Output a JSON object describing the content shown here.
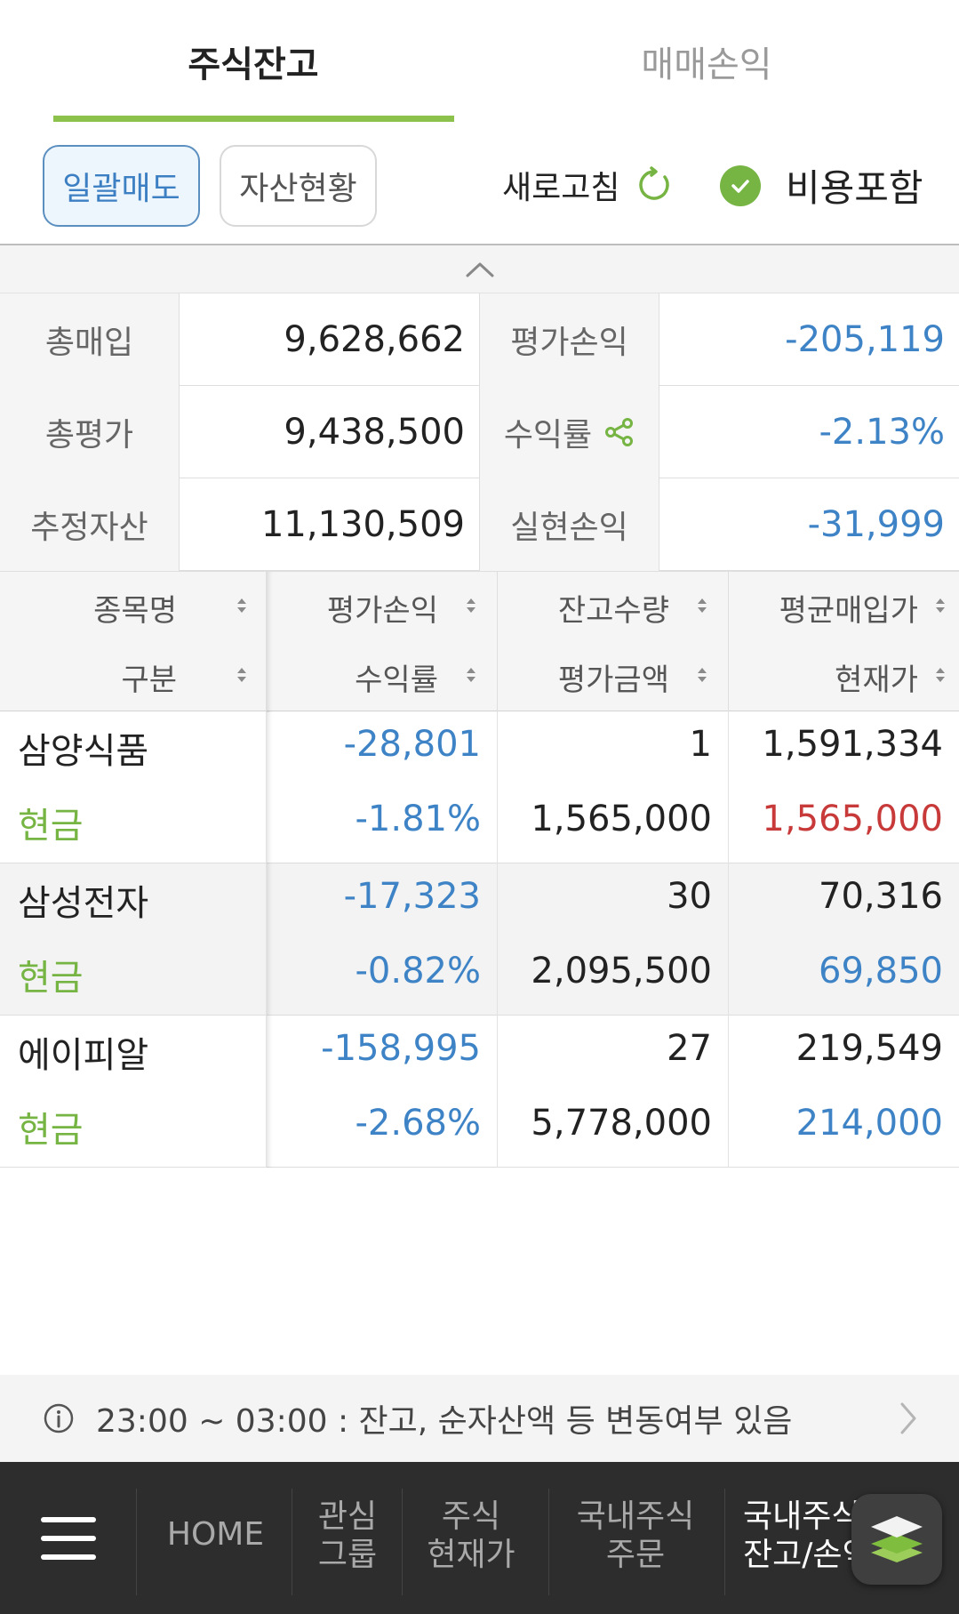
{
  "tabs": {
    "active": "주식잔고",
    "inactive": "매매손익"
  },
  "actions": {
    "bulk_sell": "일괄매도",
    "asset_status": "자산현황",
    "refresh": "새로고침",
    "include_fees": "비용포함"
  },
  "summary": {
    "rows": [
      {
        "label1": "총매입",
        "value1": "9,628,662",
        "label2": "평가손익",
        "value2": "-205,119"
      },
      {
        "label1": "총평가",
        "value1": "9,438,500",
        "label2": "수익률",
        "value2": "-2.13%"
      },
      {
        "label1": "추정자산",
        "value1": "11,130,509",
        "label2": "실현손익",
        "value2": "-31,999"
      }
    ]
  },
  "holdings": {
    "headers": {
      "col1_top": "종목명",
      "col1_bottom": "구분",
      "col2_top": "평가손익",
      "col2_bottom": "수익률",
      "col3_top": "잔고수량",
      "col3_bottom": "평가금액",
      "col4_top": "평균매입가",
      "col4_bottom": "현재가"
    },
    "rows": [
      {
        "name": "삼양식품",
        "type": "현금",
        "pnl": "-28,801",
        "rate": "-1.81%",
        "qty": "1",
        "eval": "1,565,000",
        "avg": "1,591,334",
        "price": "1,565,000",
        "price_color": "#c83a3a"
      },
      {
        "name": "삼성전자",
        "type": "현금",
        "pnl": "-17,323",
        "rate": "-0.82%",
        "qty": "30",
        "eval": "2,095,500",
        "avg": "70,316",
        "price": "69,850",
        "price_color": "#3d83c6"
      },
      {
        "name": "에이피알",
        "type": "현금",
        "pnl": "-158,995",
        "rate": "-2.68%",
        "qty": "27",
        "eval": "5,778,000",
        "avg": "219,549",
        "price": "214,000",
        "price_color": "#3d83c6"
      }
    ]
  },
  "notice": {
    "text": "23:00 ~ 03:00 : 잔고, 순자산액 등 변동여부 있음"
  },
  "bottom_nav": {
    "home": "HOME",
    "item1_line1": "관심",
    "item1_line2": "그룹",
    "item2_line1": "주식",
    "item2_line2": "현재가",
    "item3_line1": "국내주식",
    "item3_line2": "주문",
    "item4_line1": "국내주식",
    "item4_line2": "잔고/손익"
  },
  "colors": {
    "accent_green": "#8cc14c",
    "check_green": "#76b443",
    "negative_blue": "#3d83c6",
    "price_red": "#c83a3a"
  },
  "icons": [
    "refresh-icon",
    "check-circle-icon",
    "chevron-up-icon",
    "share-icon",
    "sort-icon",
    "info-icon",
    "chevron-right-icon",
    "hamburger-menu-icon",
    "layers-icon"
  ]
}
